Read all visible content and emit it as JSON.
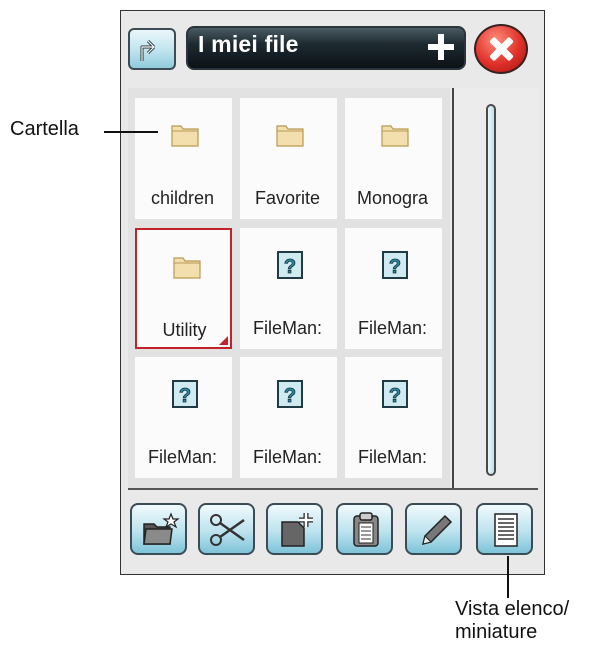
{
  "header": {
    "path_label": "I miei file",
    "up_icon": "folder-up-icon",
    "add_icon": "plus-icon",
    "close_icon": "close-icon"
  },
  "files": [
    {
      "name": "children",
      "icon": "folder-icon",
      "selected": false
    },
    {
      "name": "Favorite",
      "icon": "folder-icon",
      "selected": false
    },
    {
      "name": "Monogra",
      "icon": "folder-icon",
      "selected": false
    },
    {
      "name": "Utility",
      "icon": "folder-icon",
      "selected": true
    },
    {
      "name": "FileMan:",
      "icon": "unknown-file-icon",
      "selected": false
    },
    {
      "name": "FileMan:",
      "icon": "unknown-file-icon",
      "selected": false
    },
    {
      "name": "FileMan:",
      "icon": "unknown-file-icon",
      "selected": false
    },
    {
      "name": "FileMan:",
      "icon": "unknown-file-icon",
      "selected": false
    },
    {
      "name": "FileMan:",
      "icon": "unknown-file-icon",
      "selected": false
    }
  ],
  "toolbar": [
    {
      "icon": "new-folder-icon"
    },
    {
      "icon": "scissors-icon"
    },
    {
      "icon": "new-file-icon"
    },
    {
      "icon": "paste-icon"
    },
    {
      "icon": "pencil-icon"
    },
    {
      "icon": "list-view-icon"
    }
  ],
  "annotations": {
    "folder_callout": "Cartella",
    "view_callout_line1": "Vista elenco/",
    "view_callout_line2": "miniature"
  },
  "colors": {
    "selection": "#c2232a",
    "accent": "#bde3ee",
    "close": "#e0312a"
  }
}
